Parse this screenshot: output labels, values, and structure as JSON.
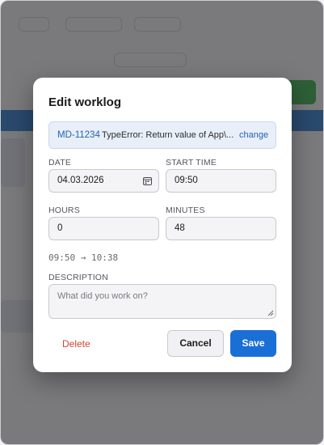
{
  "modal": {
    "title": "Edit worklog",
    "issue": {
      "key": "MD-11234",
      "summary": "TypeError: Return value of App\\...",
      "change_label": "change"
    },
    "fields": {
      "date": {
        "label": "DATE",
        "value": "04.03.2026"
      },
      "start_time": {
        "label": "START TIME",
        "value": "09:50"
      },
      "hours": {
        "label": "HOURS",
        "value": "0"
      },
      "minutes": {
        "label": "MINUTES",
        "value": "48"
      }
    },
    "time_range": "09:50 → 10:38",
    "description": {
      "label": "DESCRIPTION",
      "value": "",
      "placeholder": "What did you work on?"
    },
    "actions": {
      "delete_label": "Delete",
      "cancel_label": "Cancel",
      "save_label": "Save"
    }
  },
  "colors": {
    "accent": "#1a6fd6",
    "danger": "#d8432f",
    "link": "#2463b0",
    "issue_bg": "#e9eff8"
  }
}
